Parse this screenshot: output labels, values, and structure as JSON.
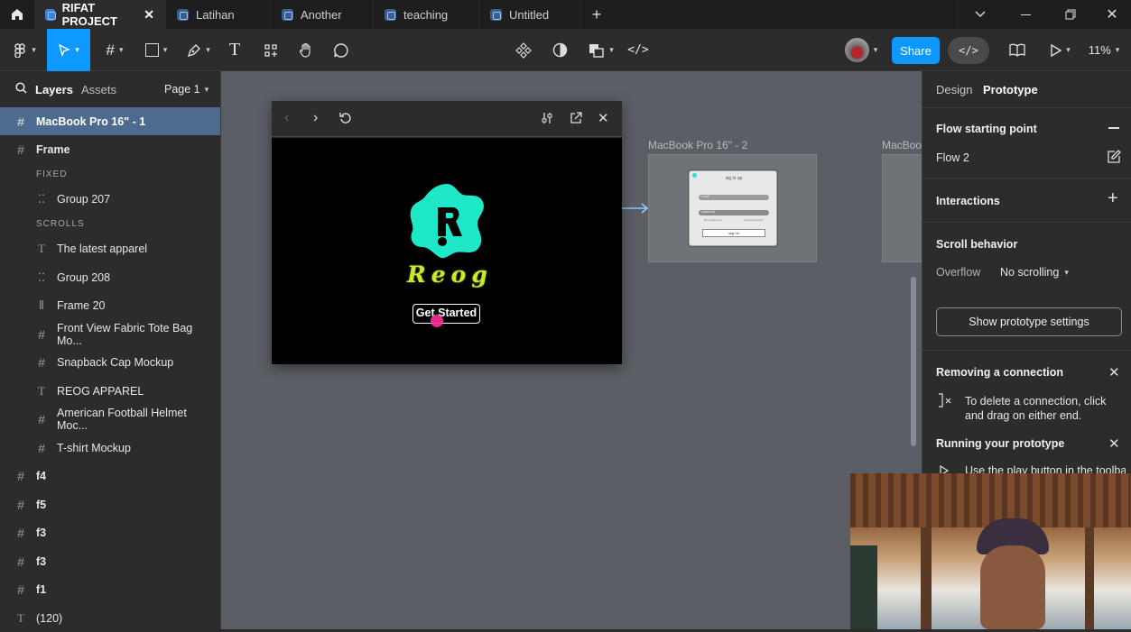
{
  "tabs": [
    {
      "label": "RIFAT PROJECT",
      "active": true
    },
    {
      "label": "Latihan"
    },
    {
      "label": "Another"
    },
    {
      "label": "teaching"
    },
    {
      "label": "Untitled"
    }
  ],
  "toolbar": {
    "share_label": "Share",
    "zoom": "11%"
  },
  "left_panel": {
    "tab_layers": "Layers",
    "tab_assets": "Assets",
    "page_selector": "Page 1",
    "selected_frame": "MacBook Pro 16\" - 1",
    "frame": "Frame",
    "section_fixed": "FIXED",
    "section_scrolls": "SCROLLS",
    "layers": [
      {
        "label": "Group 207",
        "icon": "group"
      },
      {
        "label": "The latest apparel",
        "icon": "text"
      },
      {
        "label": "Group 208",
        "icon": "group"
      },
      {
        "label": "Frame 20",
        "icon": "columns"
      },
      {
        "label": "Front View Fabric Tote Bag Mo...",
        "icon": "frame"
      },
      {
        "label": "Snapback Cap Mockup",
        "icon": "frame"
      },
      {
        "label": "REOG APPAREL",
        "icon": "text"
      },
      {
        "label": "American Football Helmet Moc...",
        "icon": "frame"
      },
      {
        "label": "T-shirt Mockup",
        "icon": "frame"
      }
    ],
    "top_layers": [
      {
        "label": "f4",
        "icon": "frame"
      },
      {
        "label": "f5",
        "icon": "frame"
      },
      {
        "label": "f3",
        "icon": "frame"
      },
      {
        "label": "f3",
        "icon": "frame"
      },
      {
        "label": "f1",
        "icon": "frame"
      },
      {
        "label": "(120)",
        "icon": "text"
      }
    ]
  },
  "canvas": {
    "frame2_label": "MacBook Pro 16\" - 2",
    "frame3_label": "MacBook",
    "preview": {
      "logo_text": "Reog",
      "button_label": "Get Started"
    },
    "thumb": {
      "title": "sig in up",
      "email": "email",
      "password": "password",
      "remember": "Remember me",
      "forgot": "forgot password",
      "button": "sign in"
    }
  },
  "right_panel": {
    "tab_design": "Design",
    "tab_prototype": "Prototype",
    "flow_title": "Flow starting point",
    "flow_name": "Flow 2",
    "interactions": "Interactions",
    "scroll_behavior": "Scroll behavior",
    "overflow_label": "Overflow",
    "overflow_value": "No scrolling",
    "proto_settings_button": "Show prototype settings",
    "removing_title": "Removing a connection",
    "removing_text": "To delete a connection, click and drag on either end.",
    "running_title": "Running your prototype",
    "running_text": "Use the play button in the toolbar"
  },
  "colors": {
    "accent_blue": "#0d99ff",
    "logo_teal": "#1fe8c8",
    "logo_lime": "#c8ea2c",
    "cursor_pink": "#ff2e9a"
  }
}
